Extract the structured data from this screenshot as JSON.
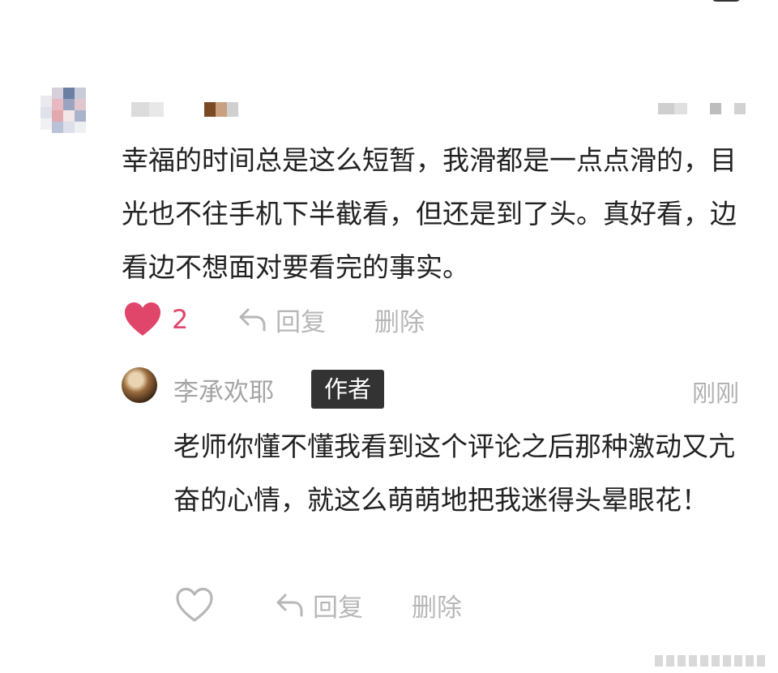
{
  "comment": {
    "text": "幸福的时间总是这么短暂，我滑都是一点点滑的，目光也不往手机下半截看，但还是到了头。真好看，边看边不想面对要看完的事实。",
    "like_count": "2",
    "reply_label": "回复",
    "delete_label": "删除",
    "liked": true
  },
  "reply": {
    "author_name": "李承欢耶",
    "author_badge": "作者",
    "time": "刚刚",
    "text": "老师你懂不懂我看到这个评论之后那种激动又亢奋的心情，就这么萌萌地把我迷得头晕眼花！",
    "reply_label": "回复",
    "delete_label": "删除",
    "liked": false
  },
  "colors": {
    "like_accent": "#e0456a",
    "muted_text": "#b7b7b7",
    "badge_bg": "#333333"
  },
  "icons": {
    "like": "heart-filled-icon",
    "like_empty": "heart-outline-icon",
    "reply": "reply-arrow-icon"
  }
}
